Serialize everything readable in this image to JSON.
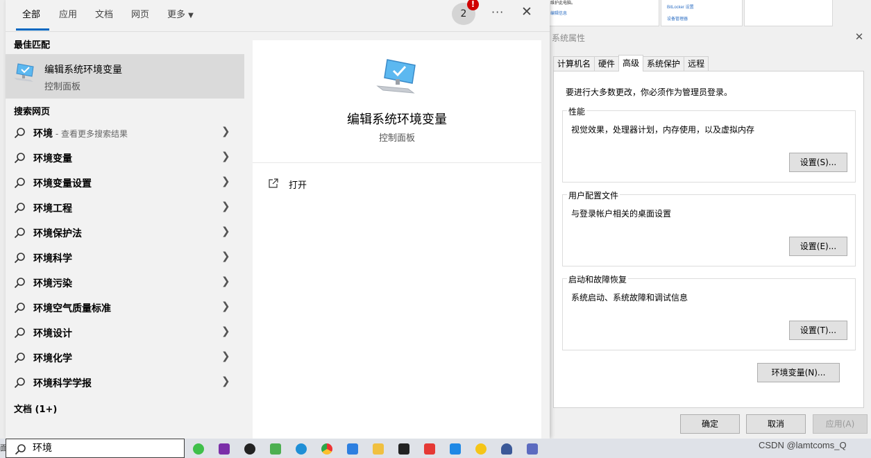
{
  "search": {
    "tabs": [
      "全部",
      "应用",
      "文档",
      "网页",
      "更多"
    ],
    "badge_count": "2",
    "alert": "!",
    "best_match_heading": "最佳匹配",
    "best_match": {
      "title": "编辑系统环境变量",
      "subtitle": "控制面板"
    },
    "web_heading": "搜索网页",
    "web_results": [
      {
        "bold": "环境",
        "more": " - 查看更多搜索结果"
      },
      {
        "bold": "环境变量",
        "more": ""
      },
      {
        "bold": "环境变量设置",
        "more": ""
      },
      {
        "bold": "环境工程",
        "more": ""
      },
      {
        "bold": "环境保护法",
        "more": ""
      },
      {
        "bold": "环境科学",
        "more": ""
      },
      {
        "bold": "环境污染",
        "more": ""
      },
      {
        "bold": "环境空气质量标准",
        "more": ""
      },
      {
        "bold": "环境设计",
        "more": ""
      },
      {
        "bold": "环境化学",
        "more": ""
      },
      {
        "bold": "环境科学学报",
        "more": ""
      }
    ],
    "docs_heading": "文档 (1+)",
    "preview": {
      "title": "编辑系统环境变量",
      "subtitle": "控制面板",
      "open_label": "打开"
    },
    "query": "环境"
  },
  "system_properties": {
    "title": "系统属性",
    "tabs": [
      "计算机名",
      "硬件",
      "高级",
      "系统保护",
      "远程"
    ],
    "active_tab": "高级",
    "admin_note": "要进行大多数更改，你必须作为管理员登录。",
    "groups": [
      {
        "title": "性能",
        "desc": "视觉效果，处理器计划，内存使用，以及虚拟内存",
        "button": "设置(S)..."
      },
      {
        "title": "用户配置文件",
        "desc": "与登录帐户相关的桌面设置",
        "button": "设置(E)..."
      },
      {
        "title": "启动和故障恢复",
        "desc": "系统启动、系统故障和调试信息",
        "button": "设置(T)..."
      }
    ],
    "env_button": "环境变量(N)...",
    "ok": "确定",
    "cancel": "取消",
    "apply": "应用(A)"
  },
  "background_window": {
    "tiny_texts": [
      "维护此电脑。",
      "BitLocker 设置",
      "设备管理器",
      "编辑信息"
    ]
  },
  "taskbar": {
    "watermark": "CSDN @lamtcoms_Q",
    "left_char": "面"
  },
  "colors": {
    "accent": "#0067c0",
    "alert": "#d00000",
    "highlight": "#dadada"
  }
}
